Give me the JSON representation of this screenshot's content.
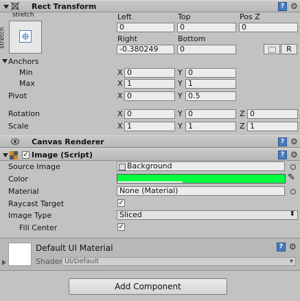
{
  "rect_transform": {
    "title": "Rect Transform",
    "anchor_preset_top": "stretch",
    "anchor_preset_side": "stretch",
    "col_left": "Left",
    "col_top": "Top",
    "col_posz": "Pos Z",
    "left": "0",
    "top": "0",
    "posz": "0",
    "col_right": "Right",
    "col_bottom": "Bottom",
    "right": "-0.380249",
    "bottom": "0",
    "r_button": "R",
    "anchors_label": "Anchors",
    "min_label": "Min",
    "min_x": "0",
    "min_y": "0",
    "max_label": "Max",
    "max_x": "1",
    "max_y": "1",
    "pivot_label": "Pivot",
    "pivot_x": "0",
    "pivot_y": "0.5",
    "rotation_label": "Rotation",
    "rot_x": "0",
    "rot_y": "0",
    "rot_z": "0",
    "scale_label": "Scale",
    "scale_x": "1",
    "scale_y": "1",
    "scale_z": "1",
    "axis_x": "X",
    "axis_y": "Y",
    "axis_z": "Z"
  },
  "canvas_renderer": {
    "title": "Canvas Renderer"
  },
  "image_script": {
    "title": "Image (Script)",
    "source_image_label": "Source Image",
    "source_image_value": "Background",
    "color_label": "Color",
    "color_value": "#00ff40",
    "material_label": "Material",
    "material_value": "None (Material)",
    "raycast_label": "Raycast Target",
    "raycast_checked": "✓",
    "image_type_label": "Image Type",
    "image_type_value": "Sliced",
    "fill_center_label": "Fill Center",
    "fill_center_checked": "✓",
    "enabled_checked": "✓"
  },
  "material_section": {
    "title": "Default UI Material",
    "shader_label": "Shader",
    "shader_value": "UI/Default"
  },
  "add_component": {
    "label": "Add Component"
  },
  "icons": {
    "help": "?",
    "gear": "⚙",
    "dropdown_arrow": "▾",
    "eyedropper": "✎"
  }
}
